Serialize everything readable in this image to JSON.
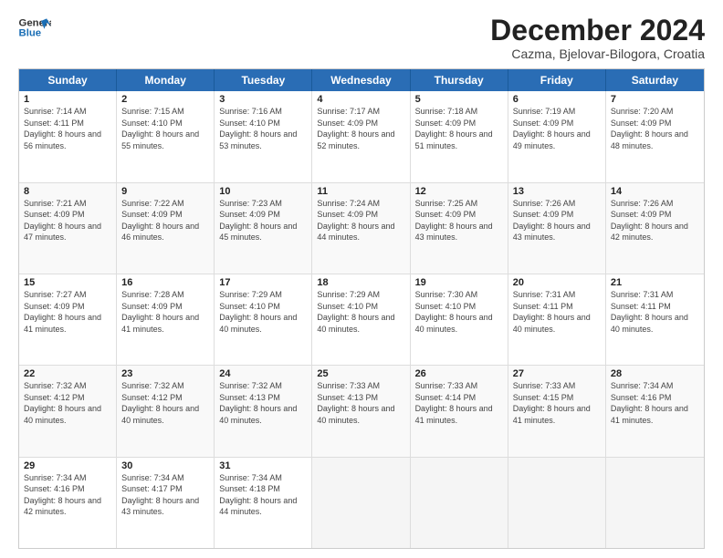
{
  "header": {
    "logo_line1": "General",
    "logo_line2": "Blue",
    "main_title": "December 2024",
    "subtitle": "Cazma, Bjelovar-Bilogora, Croatia"
  },
  "weekdays": [
    "Sunday",
    "Monday",
    "Tuesday",
    "Wednesday",
    "Thursday",
    "Friday",
    "Saturday"
  ],
  "rows": [
    [
      {
        "day": "1",
        "rise": "Sunrise: 7:14 AM",
        "set": "Sunset: 4:11 PM",
        "daylight": "Daylight: 8 hours and 56 minutes."
      },
      {
        "day": "2",
        "rise": "Sunrise: 7:15 AM",
        "set": "Sunset: 4:10 PM",
        "daylight": "Daylight: 8 hours and 55 minutes."
      },
      {
        "day": "3",
        "rise": "Sunrise: 7:16 AM",
        "set": "Sunset: 4:10 PM",
        "daylight": "Daylight: 8 hours and 53 minutes."
      },
      {
        "day": "4",
        "rise": "Sunrise: 7:17 AM",
        "set": "Sunset: 4:09 PM",
        "daylight": "Daylight: 8 hours and 52 minutes."
      },
      {
        "day": "5",
        "rise": "Sunrise: 7:18 AM",
        "set": "Sunset: 4:09 PM",
        "daylight": "Daylight: 8 hours and 51 minutes."
      },
      {
        "day": "6",
        "rise": "Sunrise: 7:19 AM",
        "set": "Sunset: 4:09 PM",
        "daylight": "Daylight: 8 hours and 49 minutes."
      },
      {
        "day": "7",
        "rise": "Sunrise: 7:20 AM",
        "set": "Sunset: 4:09 PM",
        "daylight": "Daylight: 8 hours and 48 minutes."
      }
    ],
    [
      {
        "day": "8",
        "rise": "Sunrise: 7:21 AM",
        "set": "Sunset: 4:09 PM",
        "daylight": "Daylight: 8 hours and 47 minutes."
      },
      {
        "day": "9",
        "rise": "Sunrise: 7:22 AM",
        "set": "Sunset: 4:09 PM",
        "daylight": "Daylight: 8 hours and 46 minutes."
      },
      {
        "day": "10",
        "rise": "Sunrise: 7:23 AM",
        "set": "Sunset: 4:09 PM",
        "daylight": "Daylight: 8 hours and 45 minutes."
      },
      {
        "day": "11",
        "rise": "Sunrise: 7:24 AM",
        "set": "Sunset: 4:09 PM",
        "daylight": "Daylight: 8 hours and 44 minutes."
      },
      {
        "day": "12",
        "rise": "Sunrise: 7:25 AM",
        "set": "Sunset: 4:09 PM",
        "daylight": "Daylight: 8 hours and 43 minutes."
      },
      {
        "day": "13",
        "rise": "Sunrise: 7:26 AM",
        "set": "Sunset: 4:09 PM",
        "daylight": "Daylight: 8 hours and 43 minutes."
      },
      {
        "day": "14",
        "rise": "Sunrise: 7:26 AM",
        "set": "Sunset: 4:09 PM",
        "daylight": "Daylight: 8 hours and 42 minutes."
      }
    ],
    [
      {
        "day": "15",
        "rise": "Sunrise: 7:27 AM",
        "set": "Sunset: 4:09 PM",
        "daylight": "Daylight: 8 hours and 41 minutes."
      },
      {
        "day": "16",
        "rise": "Sunrise: 7:28 AM",
        "set": "Sunset: 4:09 PM",
        "daylight": "Daylight: 8 hours and 41 minutes."
      },
      {
        "day": "17",
        "rise": "Sunrise: 7:29 AM",
        "set": "Sunset: 4:10 PM",
        "daylight": "Daylight: 8 hours and 40 minutes."
      },
      {
        "day": "18",
        "rise": "Sunrise: 7:29 AM",
        "set": "Sunset: 4:10 PM",
        "daylight": "Daylight: 8 hours and 40 minutes."
      },
      {
        "day": "19",
        "rise": "Sunrise: 7:30 AM",
        "set": "Sunset: 4:10 PM",
        "daylight": "Daylight: 8 hours and 40 minutes."
      },
      {
        "day": "20",
        "rise": "Sunrise: 7:31 AM",
        "set": "Sunset: 4:11 PM",
        "daylight": "Daylight: 8 hours and 40 minutes."
      },
      {
        "day": "21",
        "rise": "Sunrise: 7:31 AM",
        "set": "Sunset: 4:11 PM",
        "daylight": "Daylight: 8 hours and 40 minutes."
      }
    ],
    [
      {
        "day": "22",
        "rise": "Sunrise: 7:32 AM",
        "set": "Sunset: 4:12 PM",
        "daylight": "Daylight: 8 hours and 40 minutes."
      },
      {
        "day": "23",
        "rise": "Sunrise: 7:32 AM",
        "set": "Sunset: 4:12 PM",
        "daylight": "Daylight: 8 hours and 40 minutes."
      },
      {
        "day": "24",
        "rise": "Sunrise: 7:32 AM",
        "set": "Sunset: 4:13 PM",
        "daylight": "Daylight: 8 hours and 40 minutes."
      },
      {
        "day": "25",
        "rise": "Sunrise: 7:33 AM",
        "set": "Sunset: 4:13 PM",
        "daylight": "Daylight: 8 hours and 40 minutes."
      },
      {
        "day": "26",
        "rise": "Sunrise: 7:33 AM",
        "set": "Sunset: 4:14 PM",
        "daylight": "Daylight: 8 hours and 41 minutes."
      },
      {
        "day": "27",
        "rise": "Sunrise: 7:33 AM",
        "set": "Sunset: 4:15 PM",
        "daylight": "Daylight: 8 hours and 41 minutes."
      },
      {
        "day": "28",
        "rise": "Sunrise: 7:34 AM",
        "set": "Sunset: 4:16 PM",
        "daylight": "Daylight: 8 hours and 41 minutes."
      }
    ],
    [
      {
        "day": "29",
        "rise": "Sunrise: 7:34 AM",
        "set": "Sunset: 4:16 PM",
        "daylight": "Daylight: 8 hours and 42 minutes."
      },
      {
        "day": "30",
        "rise": "Sunrise: 7:34 AM",
        "set": "Sunset: 4:17 PM",
        "daylight": "Daylight: 8 hours and 43 minutes."
      },
      {
        "day": "31",
        "rise": "Sunrise: 7:34 AM",
        "set": "Sunset: 4:18 PM",
        "daylight": "Daylight: 8 hours and 44 minutes."
      },
      null,
      null,
      null,
      null
    ]
  ]
}
